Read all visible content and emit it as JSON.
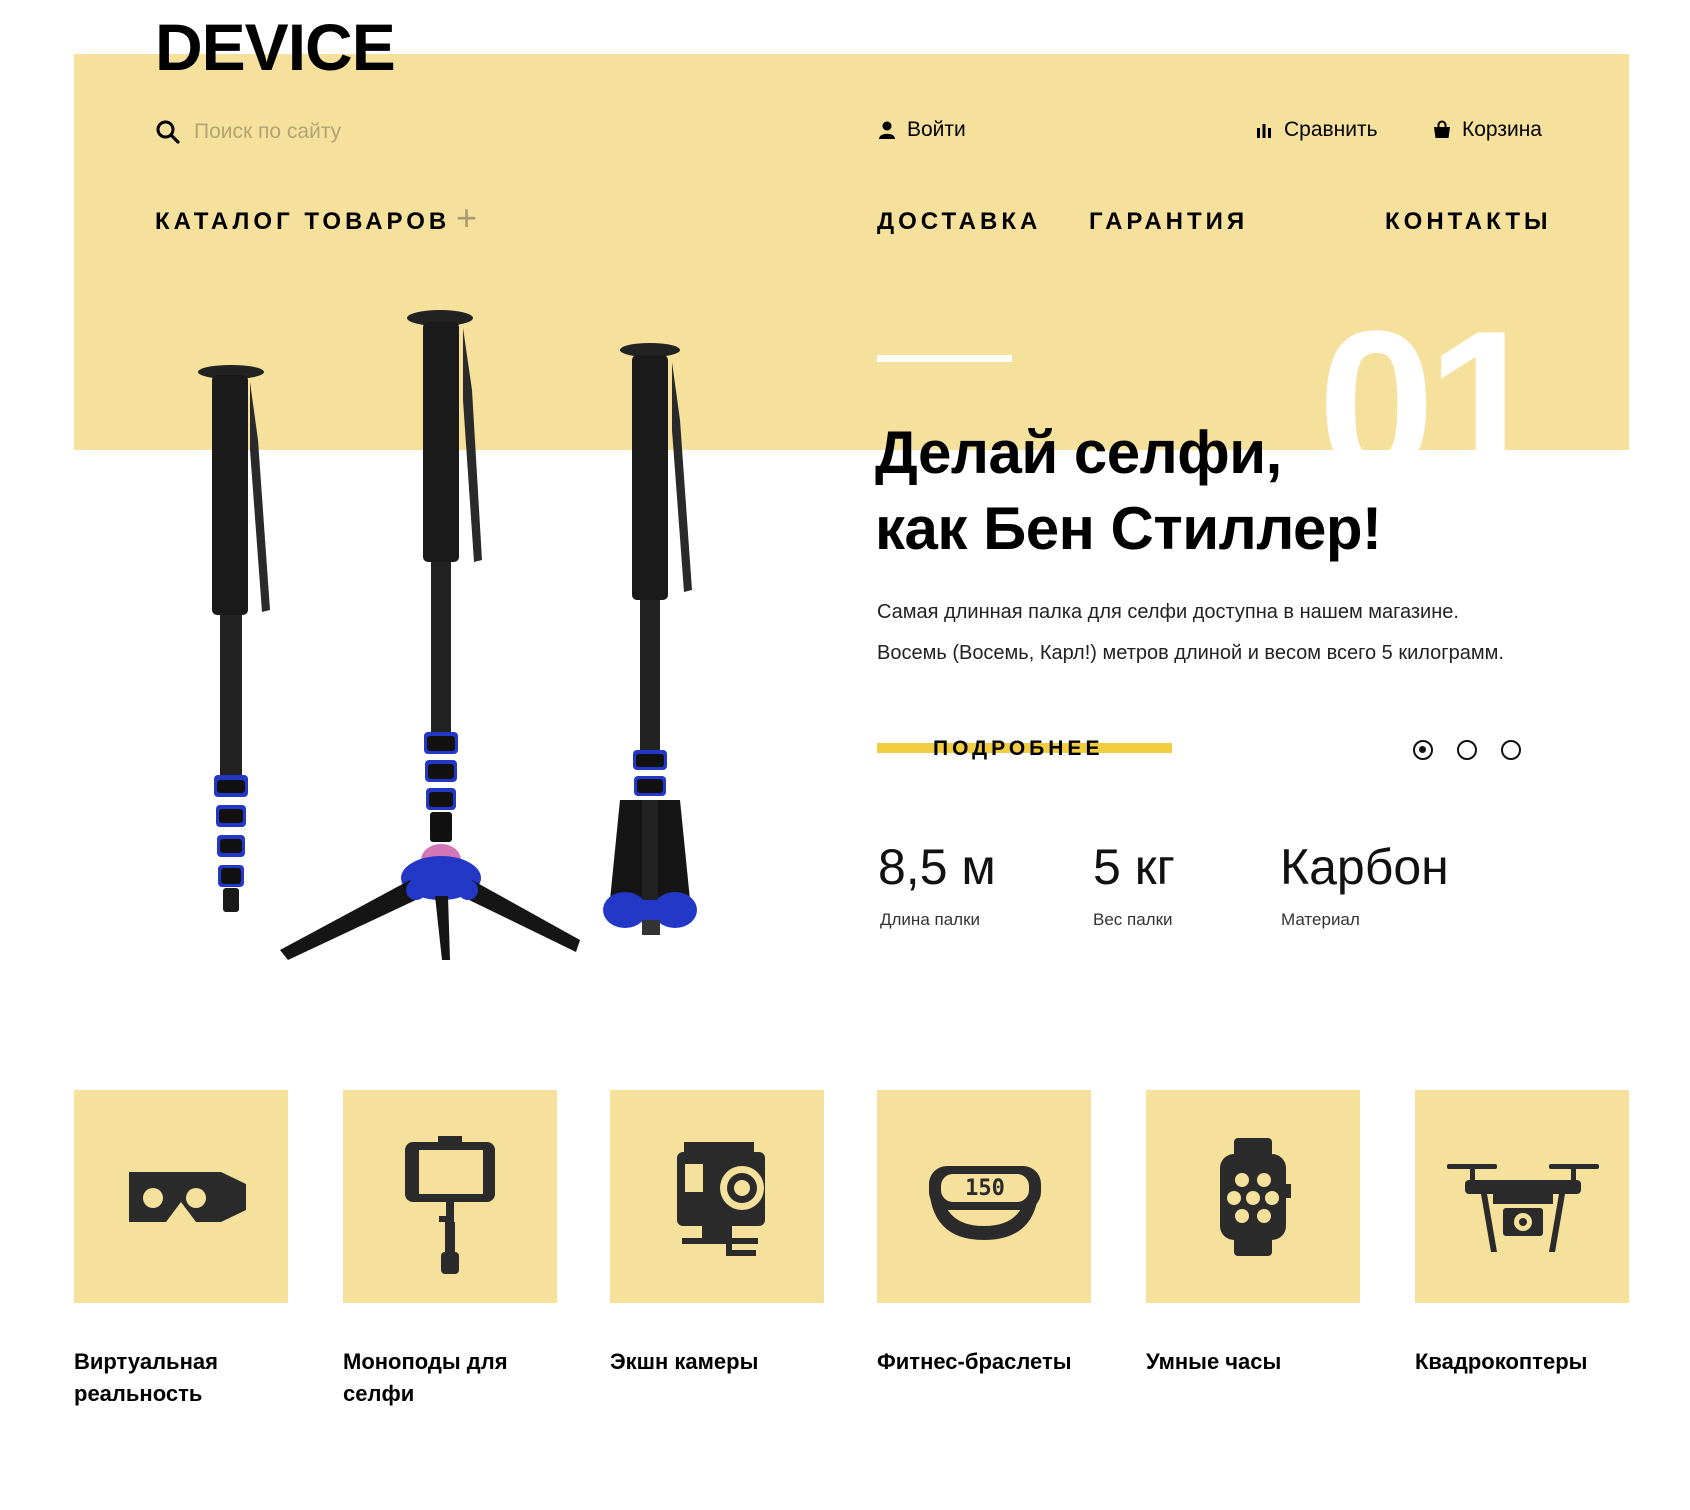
{
  "header": {
    "logo": "DEVICE",
    "search_placeholder": "Поиск по сайту",
    "login": "Войти",
    "compare": "Сравнить",
    "cart": "Корзина"
  },
  "nav": {
    "catalog": "КАТАЛОГ ТОВАРОВ",
    "delivery": "ДОСТАВКА",
    "warranty": "ГАРАНТИЯ",
    "contacts": "КОНТАКТЫ"
  },
  "hero": {
    "slide_number": "01",
    "title_line1": "Делай селфи,",
    "title_line2": "как Бен Стиллер!",
    "text_line1": "Самая длинная палка для селфи доступна в нашем магазине.",
    "text_line2": "Восемь (Восемь, Карл!) метров длиной и весом всего 5 килограмм.",
    "more_button": "ПОДРОБНЕЕ",
    "active_slide": 1,
    "slide_count": 3,
    "stats": [
      {
        "value": "8,5 м",
        "label": "Длина палки"
      },
      {
        "value": "5 кг",
        "label": "Вес палки"
      },
      {
        "value": "Карбон",
        "label": "Материал"
      }
    ]
  },
  "categories": [
    {
      "label": "Виртуальная реальность",
      "icon": "vr-headset-icon"
    },
    {
      "label": "Моноподы для селфи",
      "icon": "selfie-stick-icon"
    },
    {
      "label": "Экшн камеры",
      "icon": "action-camera-icon"
    },
    {
      "label": "Фитнес-браслеты",
      "icon": "fitness-band-icon"
    },
    {
      "label": "Умные часы",
      "icon": "smartwatch-icon"
    },
    {
      "label": "Квадрокоптеры",
      "icon": "drone-icon"
    }
  ],
  "band_display": "150",
  "colors": {
    "accent_bg": "#f5e09c",
    "accent_bar": "#f2cd42",
    "icon": "#2b2b2b",
    "monopod_blue": "#2438c8"
  }
}
